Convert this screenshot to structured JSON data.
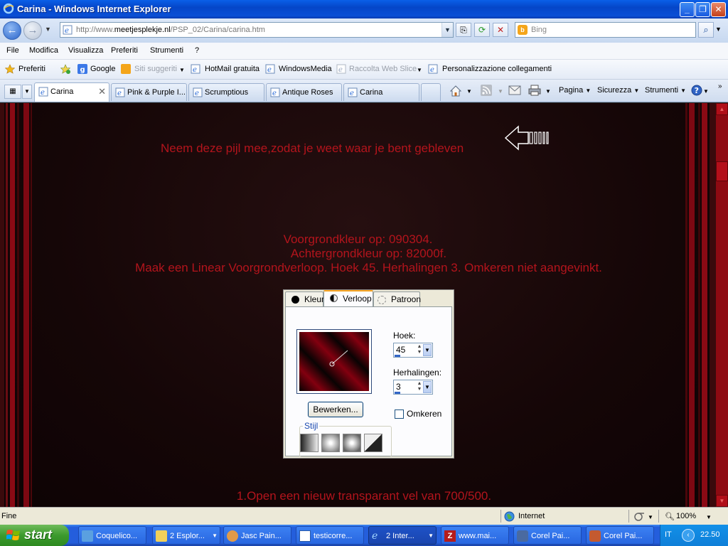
{
  "window": {
    "title": "Carina - Windows Internet Explorer",
    "controls": [
      "_",
      "❐",
      "✕"
    ]
  },
  "address": {
    "url_prefix": "http://www.",
    "url_host": "meetjesplekje.nl",
    "url_path": "/PSP_02/Carina/carina.htm",
    "search_placeholder": "Bing"
  },
  "menubar": [
    "File",
    "Modifica",
    "Visualizza",
    "Preferiti",
    "Strumenti",
    "?"
  ],
  "favorites": {
    "label": "Preferiti",
    "items": [
      {
        "label": "Google",
        "disabled": false
      },
      {
        "label": "Siti suggeriti",
        "disabled": true
      },
      {
        "label": "HotMail gratuita",
        "disabled": false
      },
      {
        "label": "WindowsMedia",
        "disabled": false
      },
      {
        "label": "Raccolta Web Slice",
        "disabled": true
      },
      {
        "label": "Personalizzazione collegamenti",
        "disabled": false
      }
    ]
  },
  "tabs": [
    {
      "label": "Carina",
      "active": true
    },
    {
      "label": "Pink & Purple I...",
      "active": false
    },
    {
      "label": "Scrumptious",
      "active": false
    },
    {
      "label": "Antique Roses",
      "active": false
    },
    {
      "label": "Carina",
      "active": false
    }
  ],
  "commandbar": {
    "pagina": "Pagina",
    "sicurezza": "Sicurezza",
    "strumenti": "Strumenti"
  },
  "content": {
    "arrow_hint": "Neem deze pijl mee,zodat je weet waar je bent gebleven",
    "line1": "Voorgrondkleur op: 090304.",
    "line2": "Achtergrondkleur op: 82000f.",
    "line3": "Maak een Linear Voorgrondverloop. Hoek 45. Herhalingen 3. Omkeren niet aangevinkt.",
    "step1": "1.Open een nieuw transparant vel van 700/500.",
    "colors": {
      "text": "#b3141c",
      "foreground": "#090304",
      "background": "#82000f"
    }
  },
  "dialog": {
    "tabs": [
      "Kleur",
      "Verloop",
      "Patroon"
    ],
    "active_tab": "Verloop",
    "hoek_label": "Hoek:",
    "hoek_value": "45",
    "herhalingen_label": "Herhalingen:",
    "herhalingen_value": "3",
    "bewerken_label": "Bewerken...",
    "omkeren_label": "Omkeren",
    "omkeren_checked": false,
    "stijl_label": "Stijl"
  },
  "statusbar": {
    "status": "Fine",
    "zone": "Internet",
    "zoom": "100%"
  },
  "taskbar": {
    "start": "start",
    "tasks": [
      {
        "label": "Coquelico...",
        "active": false
      },
      {
        "label": "2 Esplor...",
        "active": false
      },
      {
        "label": "Jasc Pain...",
        "active": false
      },
      {
        "label": "testicorre...",
        "active": false
      },
      {
        "label": "2 Inter...",
        "active": true
      },
      {
        "label": "www.mai...",
        "active": false
      },
      {
        "label": "Corel Pai...",
        "active": false
      },
      {
        "label": "Corel Pai...",
        "active": false
      }
    ],
    "language": "IT",
    "clock": "22.50"
  }
}
